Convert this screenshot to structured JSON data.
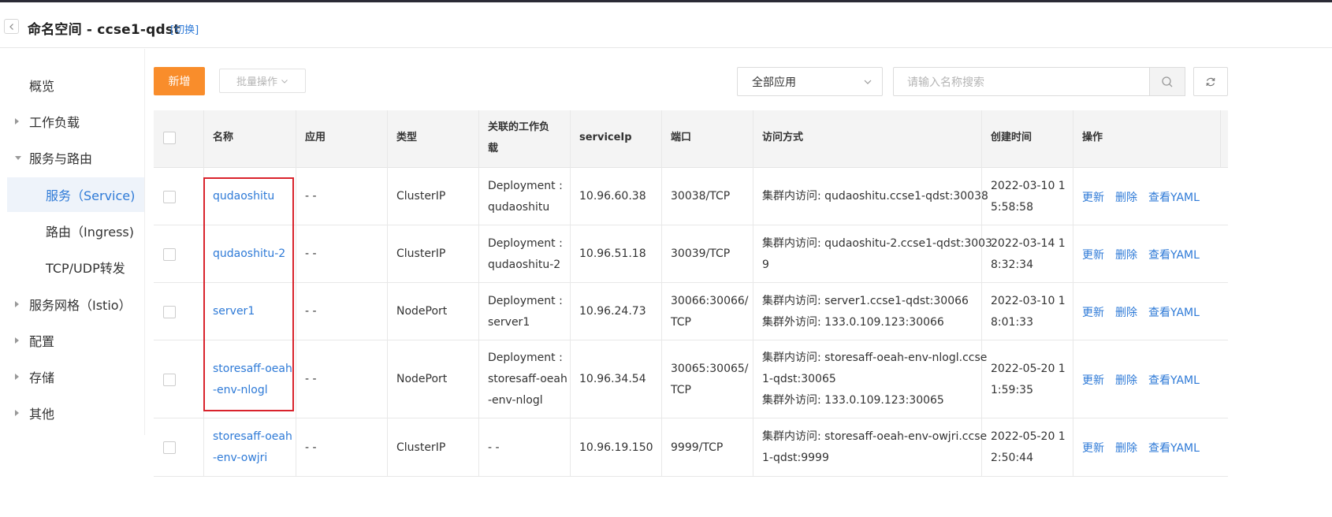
{
  "header": {
    "title": "命名空间 - ccse1-qdst",
    "switch_label": "[切换]"
  },
  "sidebar": {
    "items": [
      {
        "label": "概览",
        "arrow": "none"
      },
      {
        "label": "工作负载",
        "arrow": "right"
      },
      {
        "label": "服务与路由",
        "arrow": "down"
      },
      {
        "label": "服务（Service)",
        "arrow": "none",
        "sub": true,
        "active": true
      },
      {
        "label": "路由（Ingress)",
        "arrow": "none",
        "sub": true
      },
      {
        "label": "TCP/UDP转发",
        "arrow": "none",
        "sub": true
      },
      {
        "label": "服务网格（Istio）",
        "arrow": "right"
      },
      {
        "label": "配置",
        "arrow": "right"
      },
      {
        "label": "存储",
        "arrow": "right"
      },
      {
        "label": "其他",
        "arrow": "right"
      }
    ]
  },
  "toolbar": {
    "add_label": "新增",
    "batch_label": "批量操作",
    "app_select_value": "全部应用",
    "search_placeholder": "请输入名称搜索"
  },
  "table": {
    "headers": {
      "name": "名称",
      "app": "应用",
      "type": "类型",
      "workload": [
        "关联的工作负",
        "载"
      ],
      "serviceip": "serviceIp",
      "port": "端口",
      "access": "访问方式",
      "created": "创建时间",
      "ops": "操作"
    },
    "op_labels": {
      "update": "更新",
      "delete": "删除",
      "yaml": "查看YAML"
    },
    "rows": [
      {
        "name": [
          "qudaoshitu"
        ],
        "app": "- -",
        "type": "ClusterIP",
        "workload": [
          "Deployment :",
          "qudaoshitu"
        ],
        "ip": "10.96.60.38",
        "port": [
          "30038/TCP"
        ],
        "access": [
          "集群内访问: qudaoshitu.ccse1-qdst:30038"
        ],
        "created": [
          "2022-03-10 1",
          "5:58:58"
        ]
      },
      {
        "name": [
          "qudaoshitu-2"
        ],
        "app": "- -",
        "type": "ClusterIP",
        "workload": [
          "Deployment :",
          "qudaoshitu-2"
        ],
        "ip": "10.96.51.18",
        "port": [
          "30039/TCP"
        ],
        "access": [
          "集群内访问: qudaoshitu-2.ccse1-qdst:3003",
          "9"
        ],
        "created": [
          "2022-03-14 1",
          "8:32:34"
        ]
      },
      {
        "name": [
          "server1"
        ],
        "app": "- -",
        "type": "NodePort",
        "workload": [
          "Deployment :",
          "server1"
        ],
        "ip": "10.96.24.73",
        "port": [
          "30066:30066/",
          "TCP"
        ],
        "access": [
          "集群内访问: server1.ccse1-qdst:30066",
          "集群外访问: 133.0.109.123:30066"
        ],
        "created": [
          "2022-03-10 1",
          "8:01:33"
        ]
      },
      {
        "name": [
          "storesaff-oeah",
          "-env-nlogl"
        ],
        "app": "- -",
        "type": "NodePort",
        "workload": [
          "Deployment :",
          "storesaff-oeah",
          "-env-nlogl"
        ],
        "ip": "10.96.34.54",
        "port": [
          "30065:30065/",
          "TCP"
        ],
        "access": [
          "集群内访问: storesaff-oeah-env-nlogl.ccse",
          "1-qdst:30065",
          "集群外访问: 133.0.109.123:30065"
        ],
        "created": [
          "2022-05-20 1",
          "1:59:35"
        ]
      },
      {
        "name": [
          "storesaff-oeah",
          "-env-owjri"
        ],
        "app": "- -",
        "type": "ClusterIP",
        "workload": [
          "- -"
        ],
        "ip": "10.96.19.150",
        "port": [
          "9999/TCP"
        ],
        "access": [
          "集群内访问: storesaff-oeah-env-owjri.ccse",
          "1-qdst:9999"
        ],
        "created": [
          "2022-05-20 1",
          "2:50:44"
        ]
      }
    ]
  },
  "colors": {
    "accent": "#2e7ad7",
    "primary_button": "#f98d2b",
    "highlight_box": "#d9232c"
  }
}
